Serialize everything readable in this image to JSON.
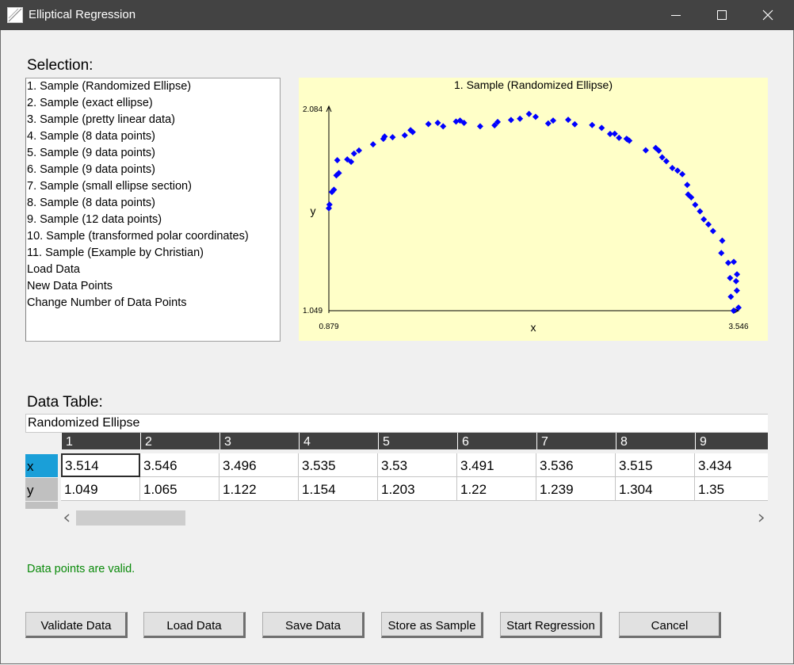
{
  "window": {
    "title": "Elliptical Regression"
  },
  "selection": {
    "label": "Selection:",
    "items": [
      "1. Sample (Randomized Ellipse)",
      "2. Sample (exact ellipse)",
      "3. Sample (pretty linear data)",
      "4. Sample (8 data points)",
      "5. Sample (9 data points)",
      "6. Sample (9 data points)",
      "7. Sample (small ellipse section)",
      "8. Sample (8 data points)",
      "9. Sample (12 data points)",
      "10. Sample (transformed polar coordinates)",
      "11. Sample (Example by Christian)",
      "Load Data",
      "New Data Points",
      "Change Number of Data Points"
    ]
  },
  "chart_data": {
    "type": "scatter",
    "title": "1. Sample (Randomized Ellipse)",
    "xlabel": "x",
    "ylabel": "y",
    "xlim": [
      0.879,
      3.546
    ],
    "ylim": [
      1.049,
      2.084
    ],
    "xlim_labels": [
      "0.879",
      "3.546"
    ],
    "ylim_labels": [
      "1.049",
      "2.084"
    ],
    "marker_color": "#0000ff",
    "background": "#ffffc8",
    "points": [
      [
        3.514,
        1.049
      ],
      [
        3.546,
        1.065
      ],
      [
        3.496,
        1.122
      ],
      [
        3.535,
        1.154
      ],
      [
        3.53,
        1.203
      ],
      [
        3.491,
        1.22
      ],
      [
        3.536,
        1.239
      ],
      [
        3.515,
        1.304
      ],
      [
        3.434,
        1.35
      ],
      [
        3.479,
        1.299
      ],
      [
        3.44,
        1.415
      ],
      [
        3.38,
        1.465
      ],
      [
        3.35,
        1.5
      ],
      [
        3.32,
        1.526
      ],
      [
        3.295,
        1.568
      ],
      [
        3.264,
        1.602
      ],
      [
        3.238,
        1.641
      ],
      [
        3.218,
        1.656
      ],
      [
        3.212,
        1.706
      ],
      [
        3.18,
        1.762
      ],
      [
        3.149,
        1.781
      ],
      [
        3.115,
        1.794
      ],
      [
        3.076,
        1.83
      ],
      [
        3.049,
        1.85
      ],
      [
        3.027,
        1.885
      ],
      [
        3.007,
        1.899
      ],
      [
        2.942,
        1.887
      ],
      [
        2.835,
        1.937
      ],
      [
        2.823,
        1.944
      ],
      [
        2.817,
        1.947
      ],
      [
        2.768,
        1.952
      ],
      [
        2.74,
        1.973
      ],
      [
        2.71,
        1.972
      ],
      [
        2.655,
        2.004
      ],
      [
        2.593,
        2.019
      ],
      [
        2.48,
        2.023
      ],
      [
        2.437,
        2.046
      ],
      [
        2.339,
        2.042
      ],
      [
        2.307,
        2.027
      ],
      [
        2.225,
        2.062
      ],
      [
        2.182,
        2.077
      ],
      [
        2.123,
        2.052
      ],
      [
        2.065,
        2.045
      ],
      [
        1.978,
        2.035
      ],
      [
        1.958,
        2.017
      ],
      [
        1.864,
        2.012
      ],
      [
        1.759,
        2.03
      ],
      [
        1.733,
        2.042
      ],
      [
        1.707,
        2.037
      ],
      [
        1.623,
        2.012
      ],
      [
        1.588,
        2.03
      ],
      [
        1.527,
        2.024
      ],
      [
        1.425,
        1.982
      ],
      [
        1.411,
        1.992
      ],
      [
        1.373,
        1.965
      ],
      [
        1.294,
        1.955
      ],
      [
        1.242,
        1.959
      ],
      [
        1.234,
        1.947
      ],
      [
        1.167,
        1.918
      ],
      [
        1.075,
        1.886
      ],
      [
        1.043,
        1.87
      ],
      [
        1.024,
        1.827
      ],
      [
        0.999,
        1.839
      ],
      [
        0.934,
        1.835
      ],
      [
        0.928,
        1.756
      ],
      [
        0.944,
        1.768
      ],
      [
        0.912,
        1.681
      ],
      [
        0.899,
        1.669
      ],
      [
        0.883,
        1.603
      ],
      [
        0.879,
        1.584
      ]
    ]
  },
  "table": {
    "label": "Data Table:",
    "name": "Randomized Ellipse",
    "columns": [
      "1",
      "2",
      "3",
      "4",
      "5",
      "6",
      "7",
      "8",
      "9"
    ],
    "rows": [
      {
        "label": "x",
        "values": [
          "3.514",
          "3.546",
          "3.496",
          "3.535",
          "3.53",
          "3.491",
          "3.536",
          "3.515",
          "3.434"
        ]
      },
      {
        "label": "y",
        "values": [
          "1.049",
          "1.065",
          "1.122",
          "1.154",
          "1.203",
          "1.22",
          "1.239",
          "1.304",
          "1.35"
        ]
      }
    ]
  },
  "status": {
    "text": "Data points are valid.",
    "color": "#0a8a0a"
  },
  "buttons": {
    "validate": "Validate Data",
    "load": "Load Data",
    "save": "Save Data",
    "store": "Store as Sample",
    "start": "Start Regression",
    "cancel": "Cancel"
  }
}
